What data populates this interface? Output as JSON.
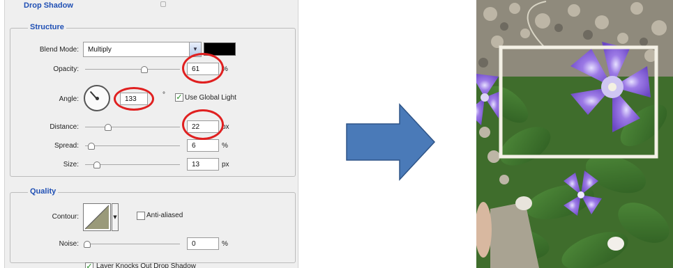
{
  "dialog": {
    "title": "Drop Shadow",
    "structure": {
      "title": "Structure",
      "blend_mode_label": "Blend Mode:",
      "blend_mode_value": "Multiply",
      "shadow_color": "#000000",
      "opacity_label": "Opacity:",
      "opacity_value": "61",
      "opacity_unit": "%",
      "angle_label": "Angle:",
      "angle_value": "133",
      "angle_unit": "°",
      "global_light_label": "Use Global Light",
      "global_light_checked": true,
      "distance_label": "Distance:",
      "distance_value": "22",
      "distance_unit": "px",
      "spread_label": "Spread:",
      "spread_value": "6",
      "spread_unit": "%",
      "size_label": "Size:",
      "size_value": "13",
      "size_unit": "px"
    },
    "quality": {
      "title": "Quality",
      "contour_label": "Contour:",
      "anti_aliased_label": "Anti-aliased",
      "anti_aliased_checked": false,
      "noise_label": "Noise:",
      "noise_value": "0",
      "noise_unit": "%",
      "knockout_label": "Layer Knocks Out Drop Shadow"
    }
  },
  "colors": {
    "highlight_circle": "#e02020",
    "arrow_fill": "#4a7ab8",
    "arrow_stroke": "#2e5487",
    "group_title": "#1f4fb4"
  },
  "icons": {
    "arrow": "right-arrow-icon",
    "contour": "contour-curve-icon",
    "dial": "angle-dial-icon"
  }
}
